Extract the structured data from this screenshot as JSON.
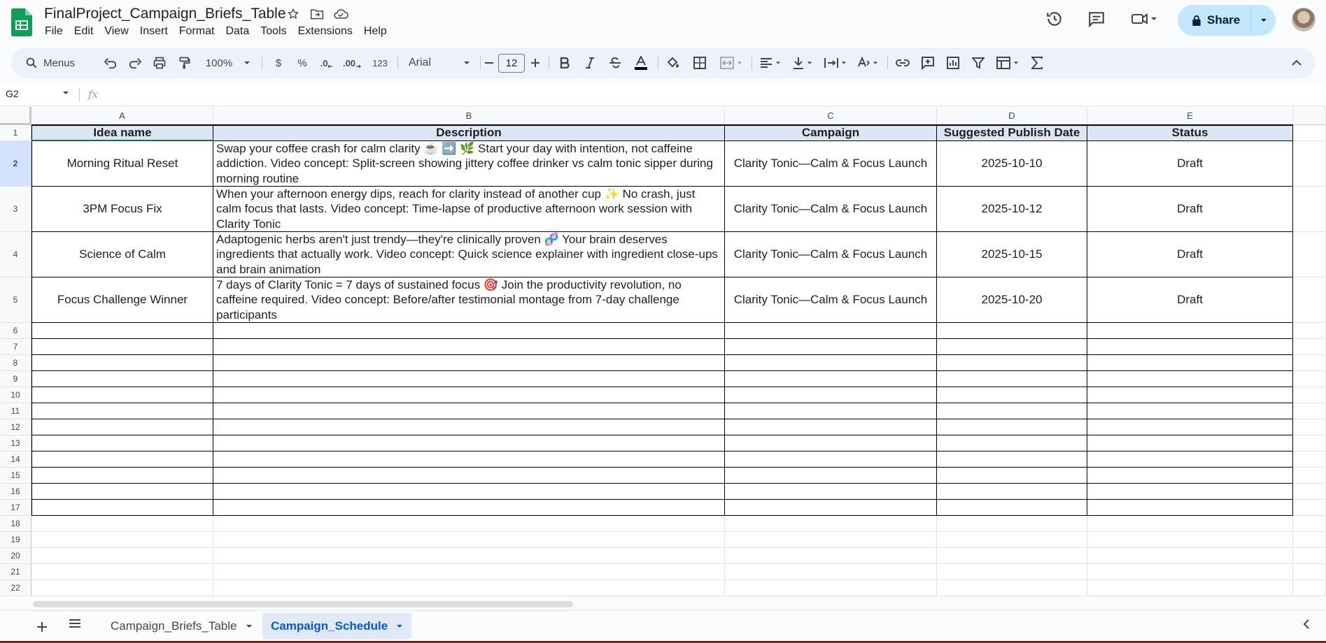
{
  "title_bar": {
    "doc_title": "FinalProject_Campaign_Briefs_Table",
    "icons": [
      "star-icon",
      "move-to-folder-icon",
      "cloud-status-icon"
    ],
    "right_icons": [
      "version-history-icon",
      "comments-icon",
      "meet-icon"
    ],
    "share_label": "Share"
  },
  "menu": {
    "items": [
      "File",
      "Edit",
      "View",
      "Insert",
      "Format",
      "Data",
      "Tools",
      "Extensions",
      "Help"
    ]
  },
  "toolbar": {
    "search_label": "Menus",
    "zoom": "100%",
    "currency": "$",
    "percent": "%",
    "decrease_decimal": ".0",
    "increase_decimal": ".00",
    "number_format": "123",
    "font_family": "Arial",
    "font_size": "12"
  },
  "formula_bar": {
    "name_box": "G2",
    "fx": "fx"
  },
  "grid": {
    "columns": [
      "A",
      "B",
      "C",
      "D",
      "E"
    ],
    "row_numbers": [
      "1",
      "2",
      "3",
      "4",
      "5",
      "6",
      "7",
      "8",
      "9",
      "10",
      "11",
      "12",
      "13",
      "14",
      "15",
      "16",
      "17",
      "18",
      "19",
      "20",
      "21",
      "22"
    ],
    "selected_row": "2",
    "header": [
      "Idea name",
      "Description",
      "Campaign",
      "Suggested Publish Date",
      "Status"
    ],
    "rows": [
      [
        "Morning Ritual Reset",
        "Swap your coffee crash for calm clarity ☕ ➡️ 🌿 Start your day with intention, not caffeine addiction. Video concept: Split-screen showing jittery coffee drinker vs calm tonic sipper during morning routine",
        "Clarity Tonic—Calm & Focus Launch",
        "2025-10-10",
        "Draft"
      ],
      [
        "3PM Focus Fix",
        "When your afternoon energy dips, reach for clarity instead of another cup ✨ No crash, just calm focus that lasts. Video concept: Time-lapse of productive afternoon work session with Clarity Tonic",
        "Clarity Tonic—Calm & Focus Launch",
        "2025-10-12",
        "Draft"
      ],
      [
        "Science of Calm",
        "Adaptogenic herbs aren't just trendy—they're clinically proven 🧬 Your brain deserves ingredients that actually work. Video concept: Quick science explainer with ingredient close-ups and brain animation",
        "Clarity Tonic—Calm & Focus Launch",
        "2025-10-15",
        "Draft"
      ],
      [
        "Focus Challenge Winner",
        "7 days of Clarity Tonic = 7 days of sustained focus 🎯 Join the productivity revolution, no caffeine required. Video concept: Before/after testimonial montage from 7-day challenge participants",
        "Clarity Tonic—Calm & Focus Launch",
        "2025-10-20",
        "Draft"
      ]
    ]
  },
  "sheets": {
    "tabs": [
      "Campaign_Briefs_Table",
      "Campaign_Schedule"
    ],
    "active": "Campaign_Schedule"
  },
  "colors": {
    "accent": "#0b57d0",
    "header_fill": "#dbe5f3",
    "share_fill": "#c2e7ff",
    "sheets_green": "#0f9d58"
  }
}
